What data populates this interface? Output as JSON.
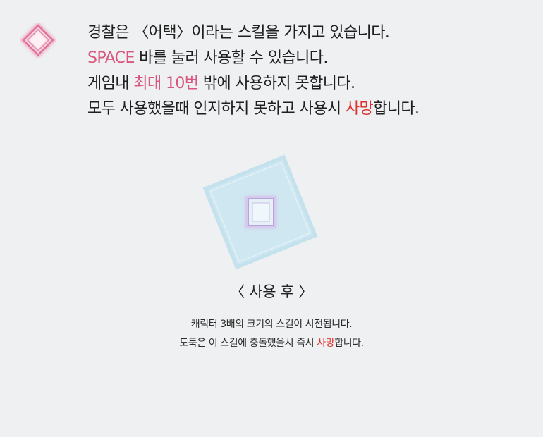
{
  "icons": {
    "intro": "pink-diamond-skill-icon",
    "illustration": "blue-square-attack-area-icon"
  },
  "colors": {
    "background": "#eef0f1",
    "highlight_pink": "#d9567e",
    "highlight_red": "#e0332f",
    "area_fill": "#cfe7f1",
    "area_border": "#b9dced"
  },
  "intro": {
    "line1": "경찰은 〈어택〉이라는 스킬을 가지고 있습니다.",
    "line2_highlight": "SPACE",
    "line2_rest": " 바를 눌러 사용할 수 있습니다.",
    "line3_pre": "게임내 ",
    "line3_highlight": "최대 10번",
    "line3_rest": " 밖에 사용하지 못합니다.",
    "line4_pre": "모두 사용했을때 인지하지 못하고 사용시 ",
    "line4_highlight": "사망",
    "line4_rest": "합니다."
  },
  "after": {
    "title": "〈 사용 후 〉",
    "line1": "캐릭터 3배의 크기의 스킬이 시전됩니다.",
    "line2_pre": "도둑은 이 스킬에 충돌했을시 즉시 ",
    "line2_highlight": "사망",
    "line2_rest": "합니다."
  }
}
